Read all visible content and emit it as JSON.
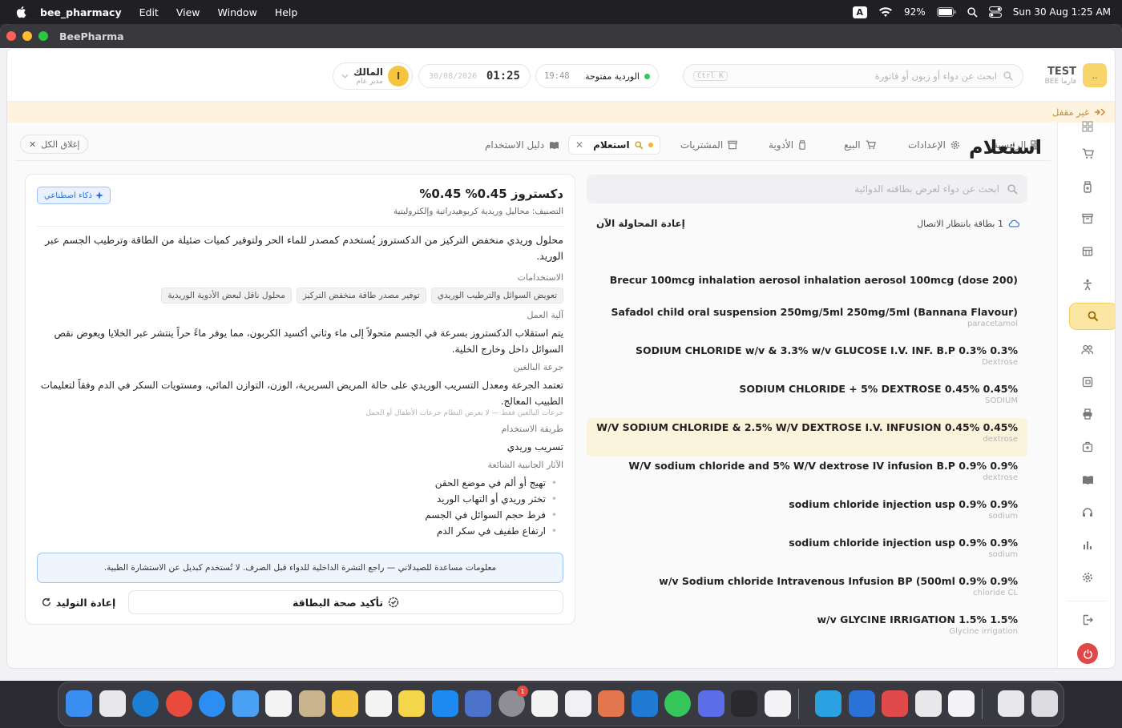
{
  "menubar": {
    "app_name": "bee_pharmacy",
    "items": [
      "Edit",
      "View",
      "Window",
      "Help"
    ],
    "input_badge": "A",
    "battery": "92%",
    "datetime": "Sun 30 Aug  1:25 AM"
  },
  "window": {
    "title": "BeePharma"
  },
  "header": {
    "brand_name": "TEST",
    "brand_sub": "BEE فارما",
    "logo_text": "..",
    "search_placeholder": "ابحث عن دواء أو زبون أو فاتورة",
    "search_shortcut": "Ctrl K",
    "shift_label": "الوردية مفتوحة",
    "shift_time": "19:48",
    "clock_time": "01:25",
    "clock_date": "30/08/2026",
    "user_initial": "ا",
    "user_name": "المالك",
    "user_role": "مدير عام"
  },
  "banner": {
    "text": "غير مقفل"
  },
  "tabs": [
    {
      "label": "الرئيسية"
    },
    {
      "label": "الإعدادات"
    },
    {
      "label": "البيع"
    },
    {
      "label": "الأدوية"
    },
    {
      "label": "المشتريات"
    },
    {
      "label": "استعلام"
    },
    {
      "label": "دليل الاستخدام"
    }
  ],
  "close_all_label": "إغلاق الكل",
  "page": {
    "title": "استعلام",
    "search_placeholder": "ابحث عن دواء لعرض بطاقته الدوائية",
    "pending_text": "1 بطاقة بانتظار الاتصال",
    "retry_label": "إعادة المحاولة الآن"
  },
  "results": [
    {
      "name": "Brecur 100mcg inhalation aerosol inhalation aerosol 100mcg (dose 200)",
      "generic": ""
    },
    {
      "name": "Safadol child oral suspension 250mg/5ml 250mg/5ml (Bannana Flavour)",
      "generic": "paracetamol"
    },
    {
      "name": "SODIUM CHLORIDE w/v & 3.3% w/v GLUCOSE I.V. INF. B.P 0.3% 0.3%",
      "generic": "Dextrose"
    },
    {
      "name": "SODIUM CHLORIDE + 5% DEXTROSE 0.45% 0.45%",
      "generic": "SODIUM"
    },
    {
      "name": "W/V SODIUM CHLORIDE & 2.5% W/V DEXTROSE I.V. INFUSION 0.45% 0.45%",
      "generic": "dextrose"
    },
    {
      "name": "W/V sodium chloride and 5% W/V dextrose IV infusion B.P 0.9% 0.9%",
      "generic": "dextrose"
    },
    {
      "name": "sodium chloride injection usp 0.9% 0.9%",
      "generic": "sodium"
    },
    {
      "name": "sodium chloride injection usp 0.9% 0.9%",
      "generic": "sodium"
    },
    {
      "name": "w/v Sodium chloride Intravenous Infusion BP (500ml 0.9% 0.9%",
      "generic": "chloride CL"
    },
    {
      "name": "w/v GLYCINE IRRIGATION 1.5% 1.5%",
      "generic": "Glycine irrigation"
    }
  ],
  "card": {
    "ai_label": "ذكاء اصطناعي",
    "drug_name": "دكستروز 0.45% 0.45%",
    "classification": "التصنيف: محاليل وريدية كربوهيدراتية وإلكتروليتية",
    "description": "محلول وريدي منخفض التركيز من الدكستروز يُستخدم كمصدر للماء الحر ولتوفير كميات ضئيلة من الطاقة وترطيب الجسم عبر الوريد.",
    "uses_title": "الاستخدامات",
    "uses": [
      "تعويض السوائل والترطيب الوريدي",
      "توفير مصدر طاقة منخفض التركيز",
      "محلول ناقل لبعض الأدوية الوريدية"
    ],
    "mechanism_title": "آلية العمل",
    "mechanism": "يتم استقلاب الدكستروز بسرعة في الجسم متحولاً إلى ماء وثاني أكسيد الكربون، مما يوفر ماءً حراً ينتشر عبر الخلايا ويعوض نقص السوائل داخل وخارج الخلية.",
    "dose_title": "جرعة البالغين",
    "dose": "تعتمد الجرعة ومعدل التسريب الوريدي على حالة المريض السريرية، الوزن، التوازن المائي، ومستويات السكر في الدم وفقاً لتعليمات الطبيب المعالج.",
    "dose_note": "جرعات البالغين فقط — لا يعرض النظام جرعات الأطفال أو الحمل",
    "route_title": "طريقة الاستخدام",
    "route": "تسريب وريدي",
    "side_effects_title": "الآثار الجانبية الشائعة",
    "side_effects": [
      "تهيج أو ألم في موضع الحقن",
      "تخثر وريدي أو التهاب الوريد",
      "فرط حجم السوائل في الجسم",
      "ارتفاع طفيف في سكر الدم"
    ],
    "info_text": "معلومات مساعدة للصيدلاني — راجع النشرة الداخلية للدواء قبل الصرف. لا تُستخدم كبديل عن الاستشارة الطبية.",
    "confirm_label": "تأكيد صحة البطاقة",
    "regen_label": "إعادة التوليد"
  },
  "dock": {
    "notification_count": "1"
  },
  "colors": {
    "accent": "#f5c542",
    "banner": "#fdf3df",
    "selected_row": "#fbf3dc",
    "danger": "#e04848"
  }
}
